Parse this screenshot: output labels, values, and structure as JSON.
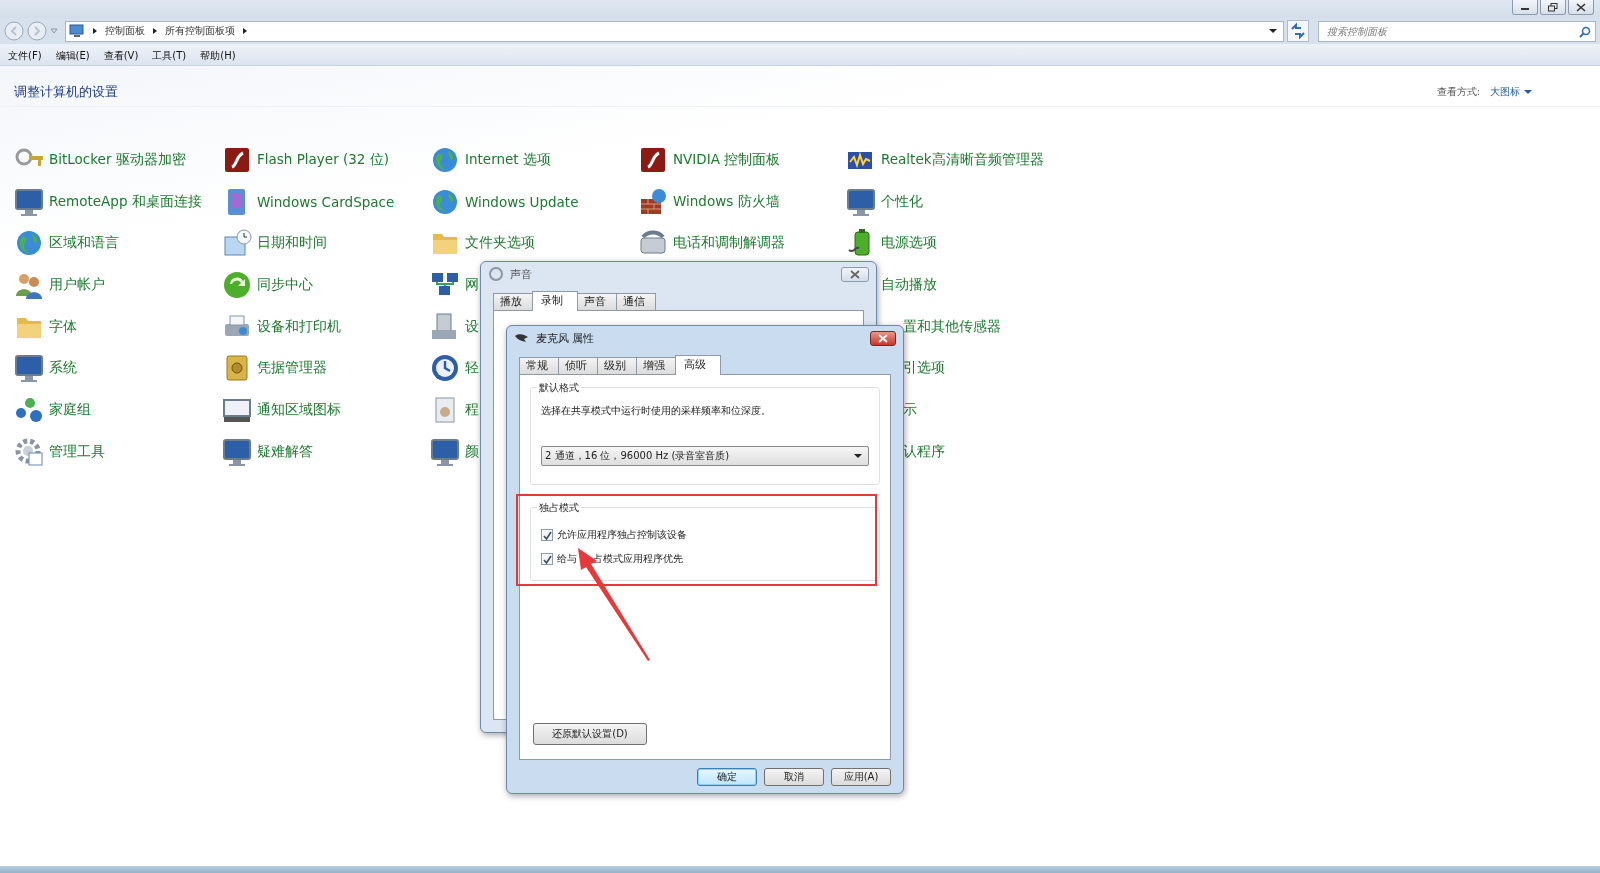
{
  "address_bar": {
    "breadcrumbs": [
      "控制面板",
      "所有控制面板项"
    ],
    "search": {
      "placeholder": "搜索控制面板"
    }
  },
  "menu": [
    "文件(F)",
    "编辑(E)",
    "查看(V)",
    "工具(T)",
    "帮助(H)"
  ],
  "header": {
    "title": "调整计算机的设置",
    "view_label": "查看方式:",
    "view_value": "大图标"
  },
  "applets": {
    "columns": [
      {
        "items": [
          {
            "label": "BitLocker 驱动器加密"
          },
          {
            "label": "RemoteApp 和桌面连接"
          },
          {
            "label": "区域和语言"
          },
          {
            "label": "用户帐户"
          },
          {
            "label": "字体"
          },
          {
            "label": "系统"
          },
          {
            "label": "家庭组"
          },
          {
            "label": "管理工具"
          }
        ]
      },
      {
        "items": [
          {
            "label": "Flash Player (32 位)"
          },
          {
            "label": "Windows CardSpace"
          },
          {
            "label": "日期和时间"
          },
          {
            "label": "同步中心"
          },
          {
            "label": "设备和打印机"
          },
          {
            "label": "凭据管理器"
          },
          {
            "label": "通知区域图标"
          },
          {
            "label": "疑难解答"
          }
        ]
      },
      {
        "items": [
          {
            "label": "Internet 选项"
          },
          {
            "label": "Windows Update"
          },
          {
            "label": "文件夹选项"
          },
          {
            "label": "网"
          },
          {
            "label": "设"
          },
          {
            "label": "轻"
          },
          {
            "label": "程"
          },
          {
            "label": "颜"
          }
        ]
      },
      {
        "items": [
          {
            "label": "NVIDIA 控制面板"
          },
          {
            "label": "Windows 防火墙"
          },
          {
            "label": "电话和调制解调器"
          }
        ]
      },
      {
        "items": [
          {
            "label": "Realtek高清晰音频管理器"
          },
          {
            "label": "个性化"
          },
          {
            "label": "电源选项"
          },
          {
            "label": "自动播放",
            "cut_start": false
          },
          {
            "label": "置和其他传感器",
            "cut_start": true
          },
          {
            "label": "引选项",
            "cut_start": true
          },
          {
            "label": "示",
            "cut_start": true
          },
          {
            "label": "认程序",
            "cut_start": true
          }
        ]
      }
    ]
  },
  "sound_dialog": {
    "title": "声音",
    "tabs": [
      {
        "label": "播放",
        "selected": false
      },
      {
        "label": "录制",
        "selected": true
      },
      {
        "label": "声音",
        "selected": false
      },
      {
        "label": "通信",
        "selected": false
      }
    ]
  },
  "properties_dialog": {
    "title": "麦克风 属性",
    "tabs": [
      {
        "label": "常规",
        "selected": false
      },
      {
        "label": "侦听",
        "selected": false
      },
      {
        "label": "级别",
        "selected": false
      },
      {
        "label": "增强",
        "selected": false
      },
      {
        "label": "高级",
        "selected": true
      }
    ],
    "default_format": {
      "heading": "默认格式",
      "description": "选择在共享模式中运行时使用的采样频率和位深度。",
      "dropdown": "2 通道，16 位，96000 Hz (录音室音质)"
    },
    "exclusive_mode": {
      "heading": "独占模式",
      "highlighted": true,
      "options": [
        {
          "label": "允许应用程序独占控制该设备",
          "checked": true
        },
        {
          "label_parts": [
            "给与",
            "占模式应用程序优先"
          ],
          "checked": true
        }
      ]
    },
    "restore_button": "还原默认设置(D)",
    "buttons": [
      {
        "label": "确定",
        "default": true
      },
      {
        "label": "取消",
        "default": false
      },
      {
        "label": "应用(A)",
        "default": false
      }
    ]
  }
}
